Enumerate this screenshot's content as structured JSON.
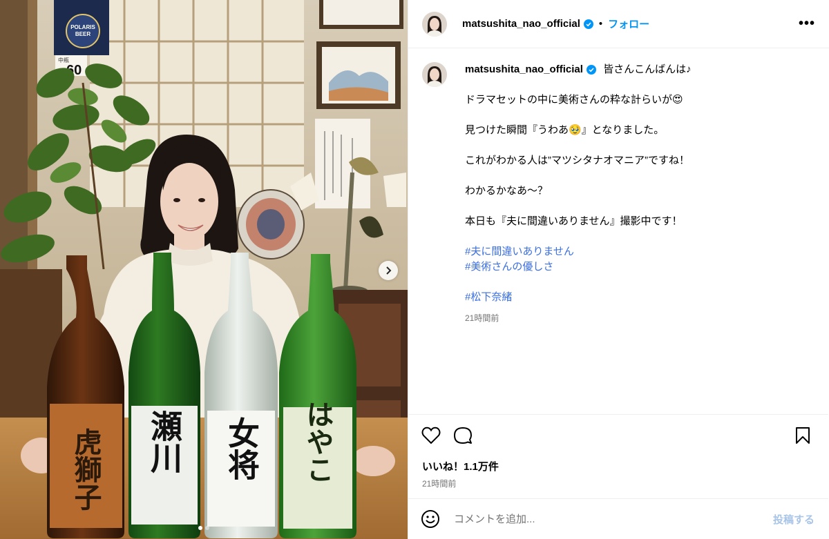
{
  "header": {
    "username": "matsushita_nao_official",
    "separator": "•",
    "follow_label": "フォロー",
    "more_label": "•••"
  },
  "photo": {
    "sign_number": "60",
    "sign_small": "中瓶",
    "beer_brand": "POLARIS BEER",
    "bottles": [
      {
        "label": "虎獅子",
        "color": "#5a2a12"
      },
      {
        "label": "瀬川",
        "color": "#1f5d1d"
      },
      {
        "label": "女将",
        "color": "#cfd6cf"
      },
      {
        "label": "はやこ",
        "color": "#2f8a2a"
      }
    ]
  },
  "caption": {
    "username": "matsushita_nao_official",
    "first_line": "皆さんこんばんは♪",
    "lines": [
      "ドラマセットの中に美術さんの粋な計らいが😍",
      "見つけた瞬間『うわあ🥹』となりました。",
      "これがわかる人は”マツシタナオマニア”ですね！",
      "わかるかなあ〜？",
      "本日も『夫に間違いありません』撮影中です！"
    ],
    "hashtags_group1": [
      "#夫に間違いありません",
      "#美術さんの優しさ"
    ],
    "hashtags_group2": [
      "#松下奈緒"
    ],
    "time": "21時間前"
  },
  "actions": {
    "likes": "いいね！1.1万件",
    "time": "21時間前"
  },
  "comment": {
    "placeholder": "コメントを追加...",
    "post_label": "投稿する"
  },
  "colors": {
    "accent": "#0095f6",
    "hashtag": "#3b6fe0",
    "muted": "#737373"
  }
}
